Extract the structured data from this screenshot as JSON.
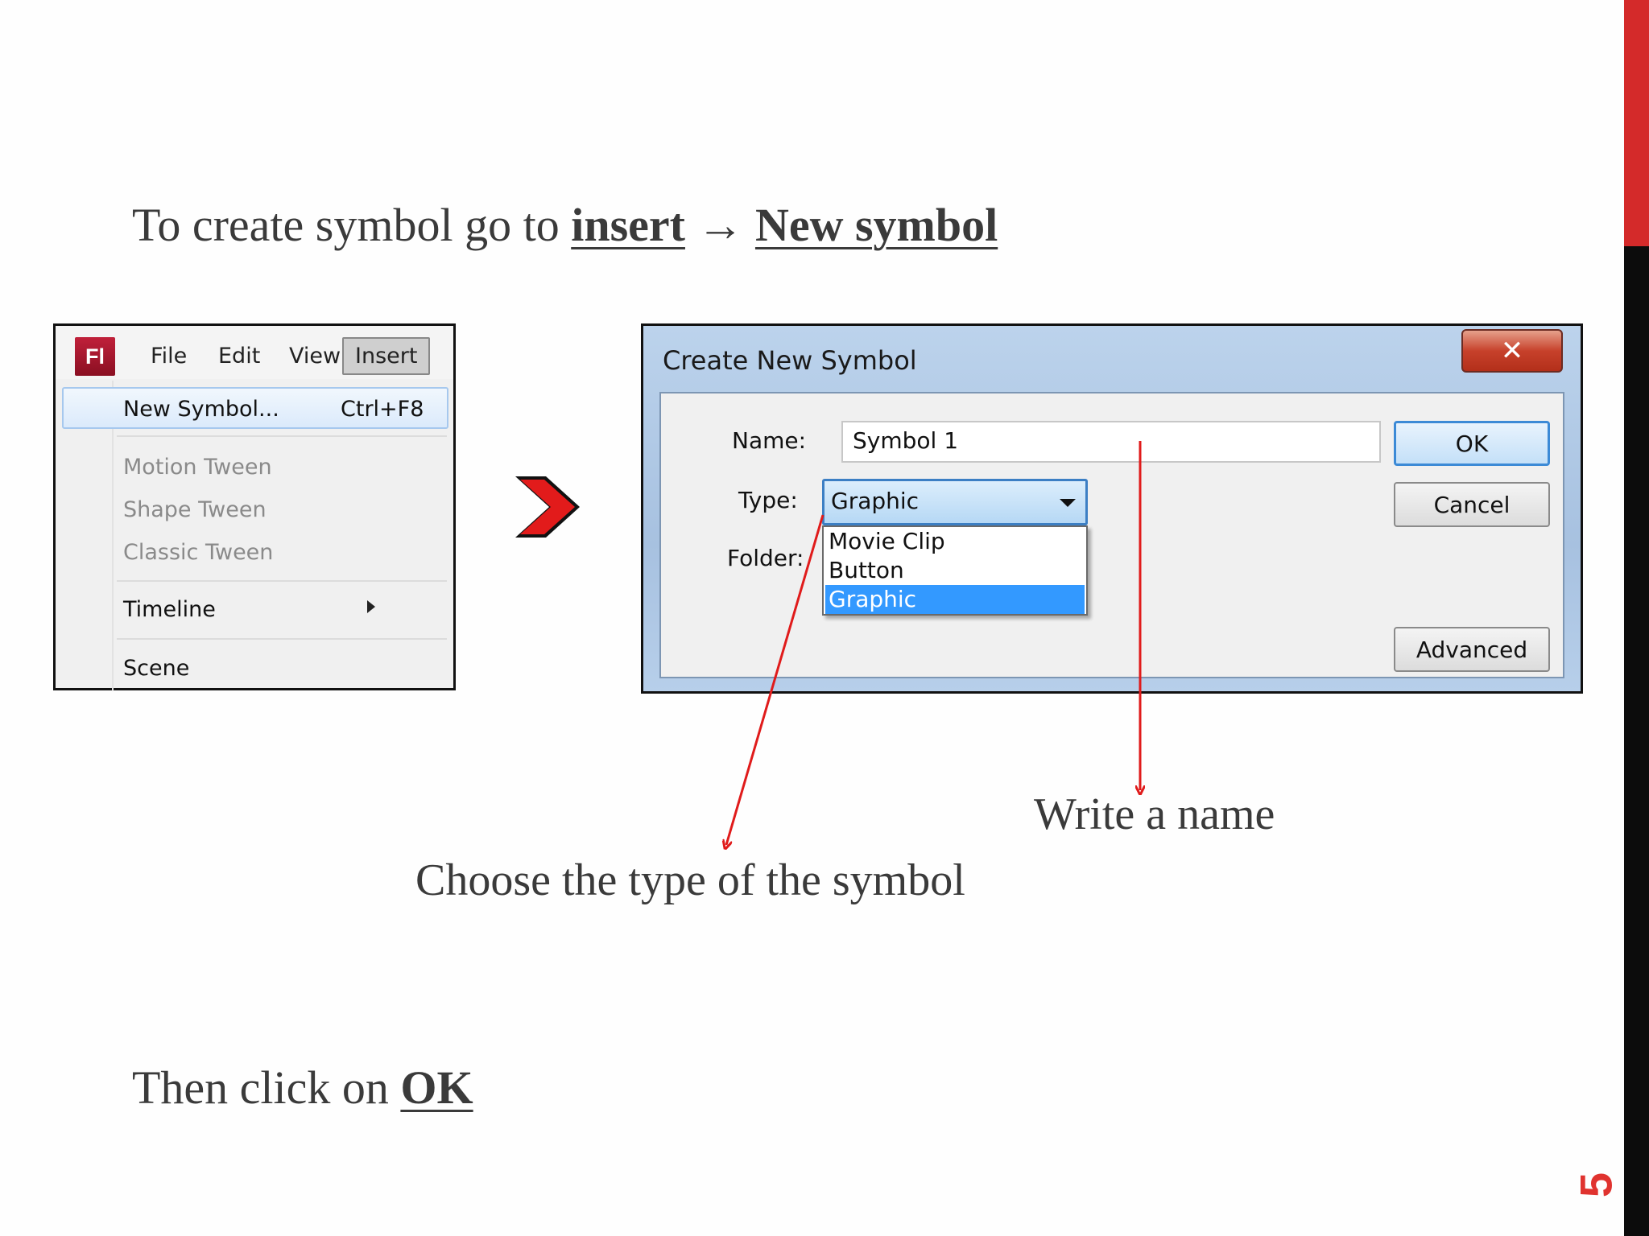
{
  "slide": {
    "line1_prefix": "To create symbol go to ",
    "line1_insert": "insert",
    "line1_arrow": " → ",
    "line1_newsymbol": "New symbol ",
    "choose_type": "Choose the type of the symbol",
    "write_name": "Write a name",
    "then_prefix": "Then click on ",
    "then_ok": "OK",
    "page_number": "5"
  },
  "menu": {
    "logo": "Fl",
    "bar": [
      "File",
      "Edit",
      "View",
      "Insert"
    ],
    "active": "Insert",
    "items": [
      {
        "label": "New Symbol...",
        "shortcut": "Ctrl+F8"
      },
      {
        "label": "Motion Tween"
      },
      {
        "label": "Shape Tween"
      },
      {
        "label": "Classic Tween"
      },
      {
        "label": "Timeline"
      },
      {
        "label": "Scene"
      }
    ]
  },
  "dialog": {
    "title": "Create New Symbol",
    "close": "✕",
    "name_label": "Name:",
    "name_value": "Symbol 1",
    "type_label": "Type:",
    "type_value": "Graphic",
    "folder_label": "Folder:",
    "options": [
      "Movie Clip",
      "Button",
      "Graphic"
    ],
    "selected_option": "Graphic",
    "ok": "OK",
    "cancel": "Cancel",
    "advanced": "Advanced"
  },
  "colors": {
    "accent_red": "#d42a2a",
    "arrow_red": "#e01b1b",
    "selection_blue": "#3399ff"
  }
}
